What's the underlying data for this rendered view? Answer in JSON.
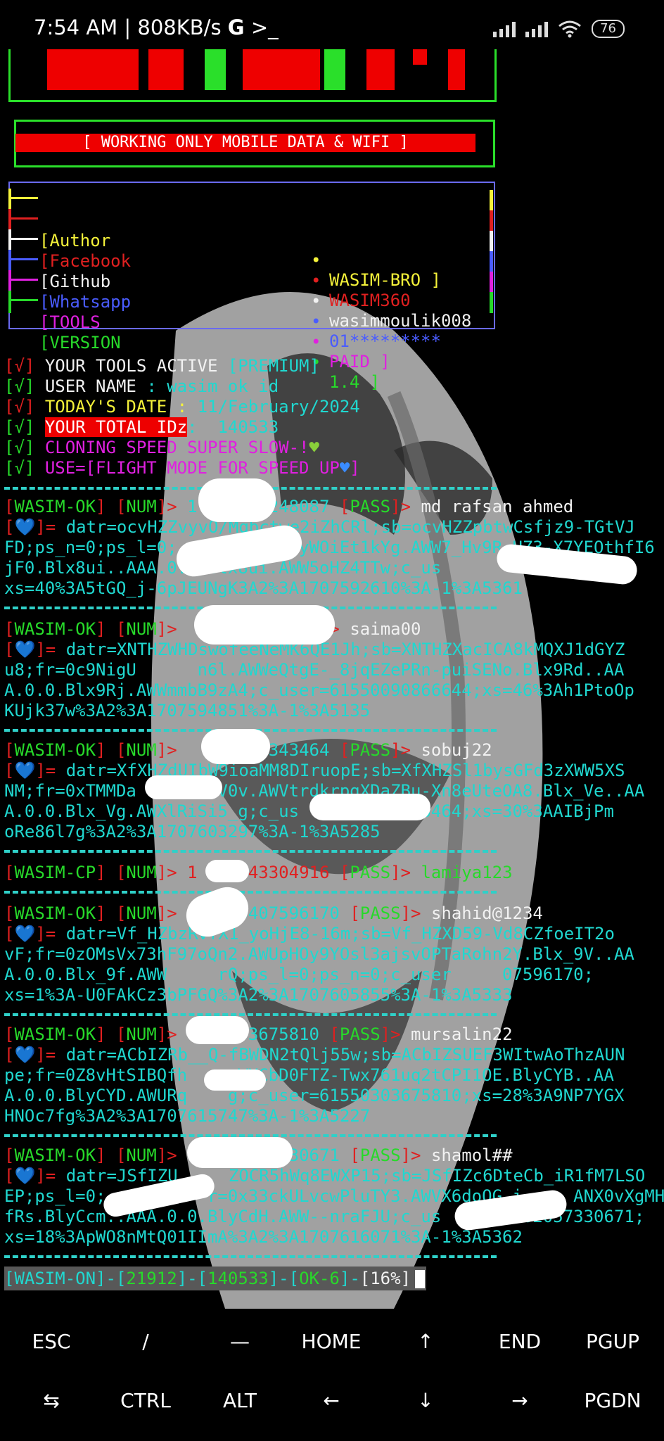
{
  "status_bar": {
    "time": "7:54 AM | 808KB/s",
    "google_glyph": "G",
    "shell_glyph": ">_",
    "battery": "76"
  },
  "banner": {
    "working_text": "[ WORKING ONLY MOBILE DATA & WIFI ]"
  },
  "info": [
    {
      "key": "[Author",
      "value": "WASIM-BRO ]",
      "color": "#f5f23a"
    },
    {
      "key": "[Facebook",
      "value": "WASIM360",
      "color": "#e02020"
    },
    {
      "key": "[Github",
      "value": "wasimmoulik008",
      "color": "#f2f2f2"
    },
    {
      "key": "[Whatsapp",
      "value": "01*********",
      "color": "#4a5cff"
    },
    {
      "key": "[TOOLS",
      "value": "PAID ]",
      "color": "#e020e0"
    },
    {
      "key": "[VERSION",
      "value": "1.4 ]",
      "color": "#27d92a"
    }
  ],
  "checks": {
    "active_label": "YOUR TOOLS ACTIVE ",
    "active_value": "[PREMIUM]",
    "user_label": "USER NAME ",
    "user_value": ": wasim ok id",
    "date_label": "TODAY'S DATE : ",
    "date_value": "11/February/2024",
    "total_label": "YOUR TOTAL IDz",
    "total_value": ":  140533",
    "speed_text": "CLONING SPEED SUPER SLOW-!",
    "use_text": "USE=[FLIGHT MODE FOR SPEED UP",
    "check_mark": "[√]"
  },
  "results": [
    {
      "status": "WASIM-OK",
      "num": "1      6248087",
      "pass": "md rafsan ahmed",
      "cookie": [
        "datr=ocvHZZvyvO/Mqbctwe2iZhCRl;sb=ocvHZZpbtwCsfjz9-TGtVJ",
        "FD;ps_n=0;ps_l=0;         IV7yWOiEt1kYg.AWW7_Hv9R-HZ3-X7YEOthfI6",
        "jF0.Blx8ui..AAA.0.0.Blx8ui.AWW5oHZ4TTw;c_us        248087;",
        "xs=40%3A5tGQ_j-6pJEUNgK3A2%3A1707592610%3A-1%3A5361"
      ]
    },
    {
      "status": "WASIM-OK",
      "num": "      4",
      "pass": "saima00",
      "cookie": [
        "datr=XNTHZWHDswofeeNeMK6QE1Jh;sb=XNTHZXacICA8kMQXJ1dGYZ",
        "u8;fr=0c9NigU      n6l.AWWeQtgE-_8jqEZePRn-puiSENo.Blx9Rd..AA",
        "A.0.0.Blx9Rj.AWWmmbB9zA4;c_user=61550090866644;xs=46%3Ah1PtoOp",
        "KUjk37w%3A2%3A1707594851%3A-1%3A5135"
      ]
    },
    {
      "status": "WASIM-OK",
      "num": "      49343464",
      "pass": "sobuj22",
      "cookie": [
        "datr=XfXHZdUIbW9ioaMM8DIruopE;sb=XfXHZSl1bysGFd3zXWW5XS",
        "NM;fr=0xTMMDa        V0v.AWVtrdkrpgXDaZBu-Xn8eUteOA8.Blx_Ve..AA",
        "A.0.0.Blx_Vg.AWXlRiSi5_g;c_us          343464;xs=30%3AAIBjPm",
        "oRe86l7g%3A2%3A1707603297%3A-1%3A5285"
      ]
    },
    {
      "status": "WASIM-CP",
      "num": "1    043304916",
      "pass": "lamiya123",
      "cookie": []
    },
    {
      "status": "WASIM-OK",
      "num": "     3407596170",
      "pass": "shahid@1234",
      "cookie": [
        "datr=Vf_HZbzRvfX1_yoHjE8-16m;sb=Vf_HZXD59-Vd8CZfoeIT2o",
        "vF;fr=0zOMsVx73hF97oQn2.AWUpHOy9YOsl3ajsvOPTaRohn2Y.Blx_9V..AA",
        "A.0.0.Blx_9f.AWW     rQ;ps_l=0;ps_n=0;c_user     07596170;",
        "xs=1%3A-U0FAkCz3bPFGQ%3A2%3A1707605855%3A-1%3A5333"
      ]
    },
    {
      "status": "WASIM-OK",
      "num": "     03675810",
      "pass": "mursalin22",
      "cookie": [
        "datr=ACbIZRb__Q-fBWDN2tQlj55w;sb=ACbIZSUEF3WItwAoThzAUN",
        "pe;fr=0Z8vHtSIBQfh     WXCbD0FTZ-Twx761uq2tCPI1OE.BlyCYB..AA",
        "A.0.0.BlyCYD.AWURq    g;c_user=61550303675810;xs=28%3A9NP7YGX",
        "HNOc7fg%3A2%3A1707615747%3A-1%3A5227"
      ]
    },
    {
      "status": "WASIM-OK",
      "num": "      057330671",
      "pass": "shamol##",
      "cookie": [
        "datr=JSfIZU     ZOCR5hWq8EWXP15;sb=JSfIZc6DteCb_iR1fM7LSO",
        "EP;ps_l=0;          r=0x33ckULvcwPluTY3.AWVX6doOG_i     ANX0vXgMH",
        "fRs.BlyCcm..AAA.0.0.BlyCdH.AWW--nraFJU;c_us      0082057330671;",
        "xs=18%3ApWO8nMtQ01IImA%3A2%3A1707616071%3A-1%3A5362"
      ]
    }
  ],
  "result_labels": {
    "num": "NUM",
    "pass": "PASS",
    "cookie_prefix": "[💙]="
  },
  "prompt": {
    "name": "WASIM-ON",
    "count": "21912",
    "total": "140533",
    "ok": "OK-6",
    "percent": "[16%]"
  },
  "keys": {
    "row1": [
      "ESC",
      "/",
      "—",
      "HOME",
      "↑",
      "END",
      "PGUP"
    ],
    "row2": [
      "⇆",
      "CTRL",
      "ALT",
      "←",
      "↓",
      "→",
      "PGDN"
    ]
  }
}
